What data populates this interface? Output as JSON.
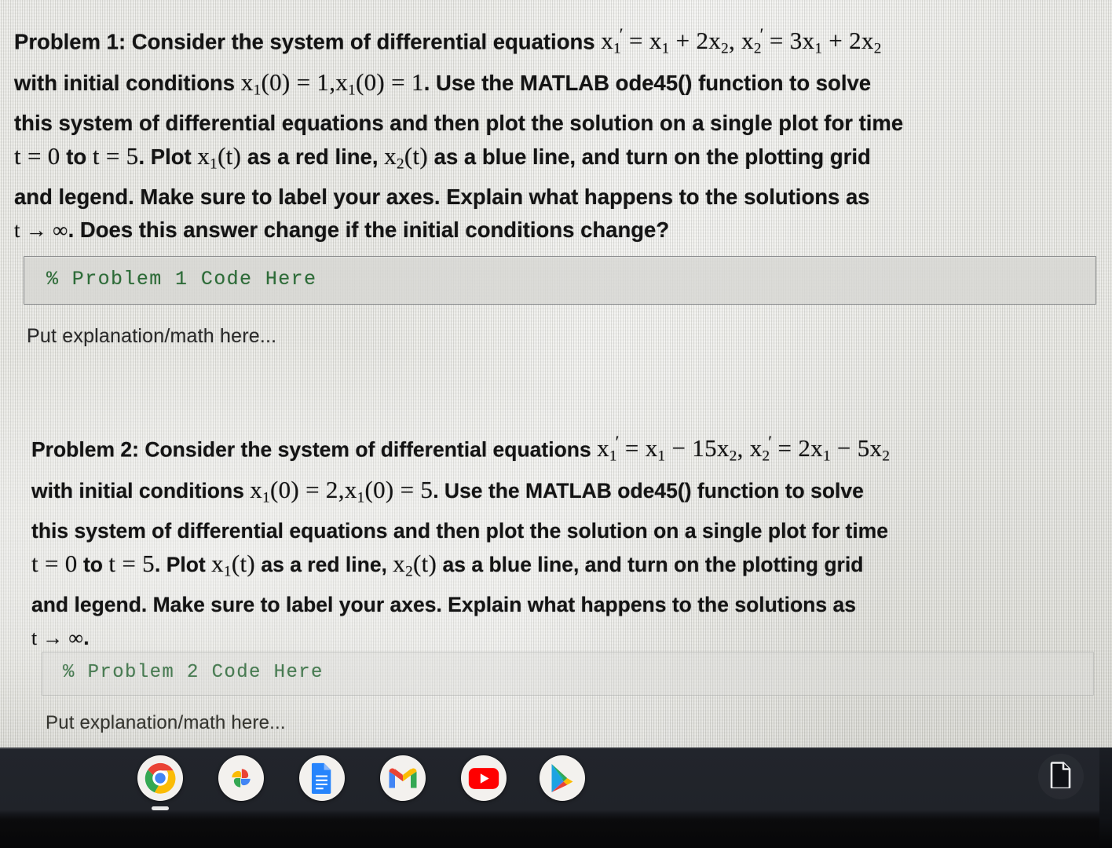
{
  "screen": {
    "problem1": {
      "heading_prefix": "Problem 1:",
      "line1_text": " Consider the system of differential equations ",
      "eq1_a": "x",
      "eq1_sub_a": "1",
      "eq1_rest_a": " = x",
      "eq1_sub_b": "1",
      "eq1_rest_b": " + 2x",
      "eq1_sub_c": "2",
      "eq1_comma": ", ",
      "eq2_a": "x",
      "eq2_sub_a": "2",
      "eq2_rest_a": " = 3x",
      "eq2_sub_b": "1",
      "eq2_rest_b": " + 2x",
      "eq2_sub_c": "2",
      "line2_pre": "with initial conditions ",
      "ic_1": "x",
      "ic_1_sub": "1",
      "ic_1_rest": "(0) = 1,",
      "ic_2": "x",
      "ic_2_sub": "1",
      "ic_2_rest": "(0) = 1",
      "line2_post": ". Use the MATLAB ode45() function to solve",
      "line3": "this system of differential equations and then plot the solution on a single plot for time",
      "line4_t0": "t = 0",
      "line4_to": " to ",
      "line4_t5": "t = 5",
      "line4_plot": ". Plot ",
      "line4_x1": "x",
      "line4_x1_sub": "1",
      "line4_x1_rest": "(t)",
      "line4_red": " as a red line, ",
      "line4_x2": "x",
      "line4_x2_sub": "2",
      "line4_x2_rest": "(t)",
      "line4_blue": " as a blue line, and turn on the plotting grid",
      "line5": "and legend.  Make sure to label your axes.  Explain what happens to the solutions as",
      "line6_limit": "t → ∞",
      "line6_rest": ". Does this answer change if the initial conditions change?",
      "code_placeholder": "% Problem 1 Code Here",
      "explanation_placeholder": "Put explanation/math here..."
    },
    "problem2": {
      "heading_prefix": "Problem 2:",
      "line1_text": " Consider the system of differential equations ",
      "eq1_a": "x",
      "eq1_sub_a": "1",
      "eq1_rest_a": " = x",
      "eq1_sub_b": "1",
      "eq1_rest_b": " − 15x",
      "eq1_sub_c": "2",
      "eq1_comma": ", ",
      "eq2_a": "x",
      "eq2_sub_a": "2",
      "eq2_rest_a": " = 2x",
      "eq2_sub_b": "1",
      "eq2_rest_b": " − 5x",
      "eq2_sub_c": "2",
      "line2_pre": "with initial conditions ",
      "ic_1": "x",
      "ic_1_sub": "1",
      "ic_1_rest": "(0) = 2,",
      "ic_2": "x",
      "ic_2_sub": "1",
      "ic_2_rest": "(0) = 5",
      "line2_post": ". Use the MATLAB ode45() function to solve",
      "line3": "this system of differential equations and then plot the solution on a single plot for time",
      "line4_t0": "t = 0",
      "line4_to": " to ",
      "line4_t5": "t = 5",
      "line4_plot": ". Plot ",
      "line4_x1": "x",
      "line4_x1_sub": "1",
      "line4_x1_rest": "(t)",
      "line4_red": " as a red line, ",
      "line4_x2": "x",
      "line4_x2_sub": "2",
      "line4_x2_rest": "(t)",
      "line4_blue": " as a blue line, and turn on the plotting grid",
      "line5": "and legend.  Make sure to label your axes.  Explain what happens to the solutions as",
      "line6_limit": "t → ∞",
      "line6_rest": ".",
      "code_placeholder": "% Problem 2 Code Here",
      "explanation_placeholder": "Put explanation/math here..."
    }
  },
  "shelf": {
    "icons": [
      {
        "name": "chrome-icon",
        "label": "Google Chrome",
        "running": true
      },
      {
        "name": "google-photos-icon",
        "label": "Google Photos",
        "running": false
      },
      {
        "name": "google-docs-icon",
        "label": "Google Docs",
        "running": false
      },
      {
        "name": "gmail-icon",
        "label": "Gmail",
        "running": false
      },
      {
        "name": "youtube-icon",
        "label": "YouTube",
        "running": false
      },
      {
        "name": "play-store-icon",
        "label": "Play Store",
        "running": false
      }
    ],
    "right_icon": {
      "name": "files-icon",
      "label": "Files"
    }
  },
  "colors": {
    "code_text_green": "#2d6b38",
    "screen_background": "#e7e7e2",
    "shelf_background": "#202329",
    "chrome_red": "#ea4335",
    "chrome_yellow": "#fbbc05",
    "chrome_green": "#34a853",
    "chrome_blue": "#4285f4",
    "youtube_red": "#ff0000",
    "docs_blue": "#2684fc",
    "gmail_red": "#ea4335"
  }
}
